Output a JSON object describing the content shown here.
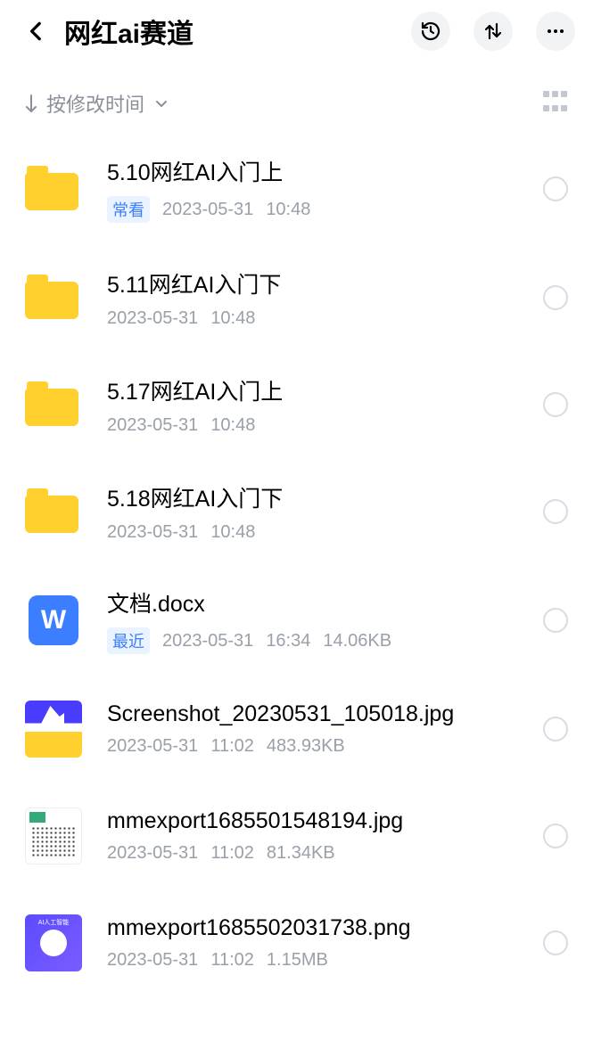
{
  "header": {
    "title": "网红ai赛道"
  },
  "sort": {
    "label": "按修改时间"
  },
  "badges": {
    "frequent": "常看",
    "recent": "最近"
  },
  "items": [
    {
      "type": "folder",
      "name": "5.10网红AI入门上",
      "badge": "frequent",
      "date": "2023-05-31",
      "time": "10:48",
      "size": ""
    },
    {
      "type": "folder",
      "name": "5.11网红AI入门下",
      "badge": "",
      "date": "2023-05-31",
      "time": "10:48",
      "size": ""
    },
    {
      "type": "folder",
      "name": "5.17网红AI入门上",
      "badge": "",
      "date": "2023-05-31",
      "time": "10:48",
      "size": ""
    },
    {
      "type": "folder",
      "name": "5.18网红AI入门下",
      "badge": "",
      "date": "2023-05-31",
      "time": "10:48",
      "size": ""
    },
    {
      "type": "doc",
      "name": "文档.docx",
      "badge": "recent",
      "date": "2023-05-31",
      "time": "16:34",
      "size": "14.06KB"
    },
    {
      "type": "img1",
      "name": "Screenshot_20230531_105018.jpg",
      "badge": "",
      "date": "2023-05-31",
      "time": "11:02",
      "size": "483.93KB"
    },
    {
      "type": "img2",
      "name": "mmexport1685501548194.jpg",
      "badge": "",
      "date": "2023-05-31",
      "time": "11:02",
      "size": "81.34KB"
    },
    {
      "type": "img3",
      "name": "mmexport1685502031738.png",
      "badge": "",
      "date": "2023-05-31",
      "time": "11:02",
      "size": "1.15MB"
    }
  ]
}
